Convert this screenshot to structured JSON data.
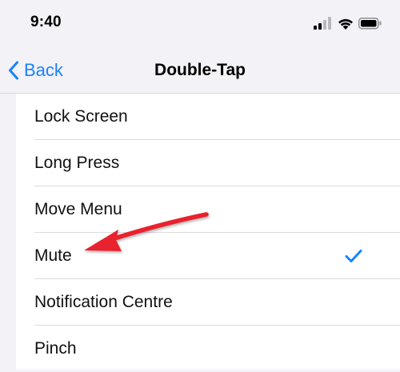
{
  "status_bar": {
    "time": "9:40",
    "icons": [
      "cellular-signal-icon",
      "wifi-icon",
      "battery-icon"
    ]
  },
  "nav": {
    "back_label": "Back",
    "title": "Double-Tap"
  },
  "list": {
    "items": [
      {
        "label": "Lock Screen",
        "selected": false
      },
      {
        "label": "Long Press",
        "selected": false
      },
      {
        "label": "Move Menu",
        "selected": false
      },
      {
        "label": "Mute",
        "selected": true
      },
      {
        "label": "Notification Centre",
        "selected": false
      },
      {
        "label": "Pinch",
        "selected": false
      }
    ]
  },
  "annotation": {
    "icon": "red-arrow-icon",
    "color": "#e8242f"
  },
  "colors": {
    "accent": "#1a82fb",
    "background": "#f2f2f7"
  }
}
